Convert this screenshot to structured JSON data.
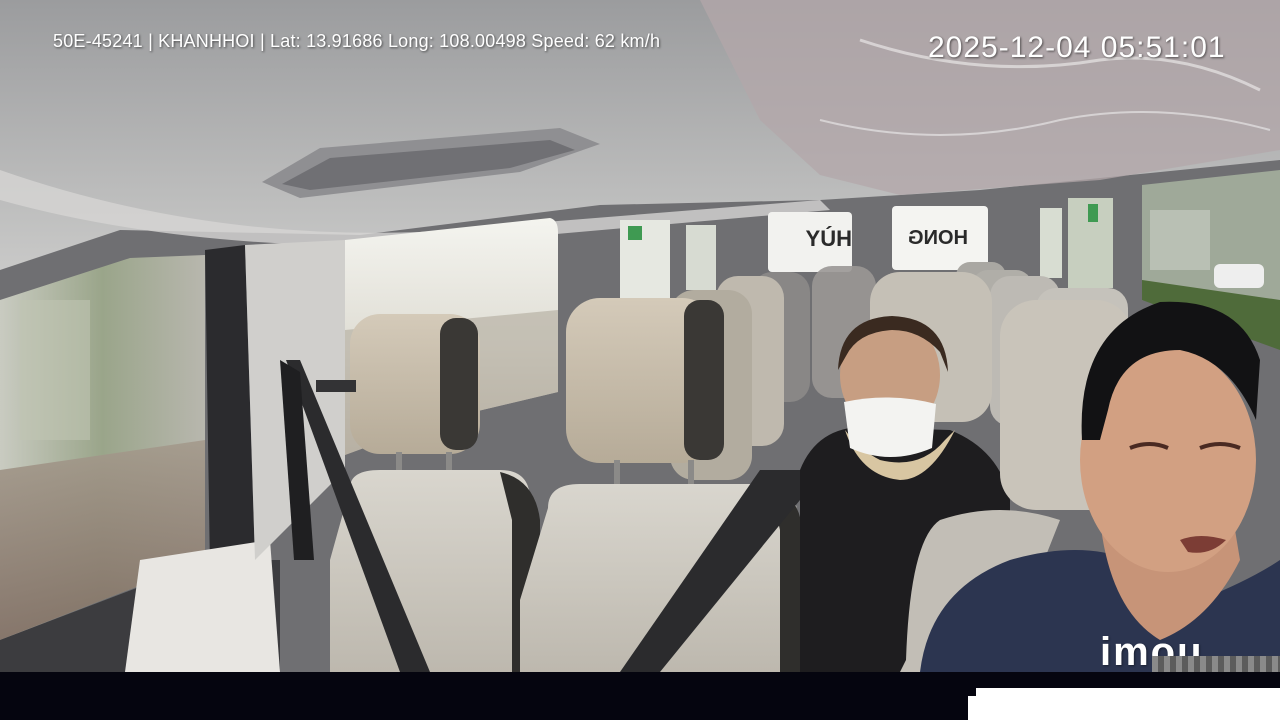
{
  "overlay": {
    "info_text": "50E-45241 | KHANHHOI | Lat: 13.91686 Long: 108.00498 Speed: 62 km/h",
    "timestamp": "2025-12-04 05:51:01"
  },
  "watermark": {
    "brand": "imou"
  },
  "colors": {
    "overlay_text": "#ffffff",
    "bottom_bar": "#05050f",
    "seat_fabric": "#cfcbc2",
    "ceiling": "#bdbcbc"
  },
  "scene": {
    "subjects": [
      "driver",
      "masked-passenger"
    ],
    "window_signs": [
      "HÙY",
      "HONG"
    ]
  }
}
